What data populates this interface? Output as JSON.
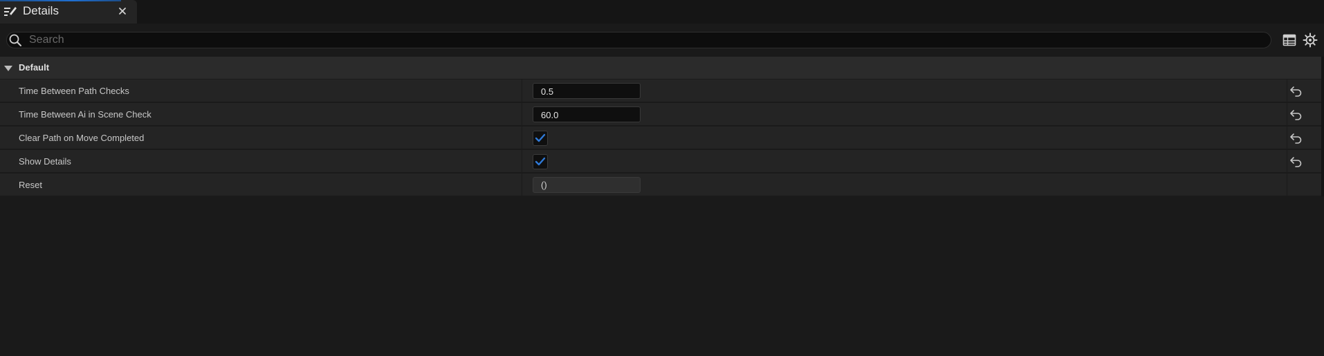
{
  "tab": {
    "title": "Details",
    "icon": "pencil-details-icon",
    "close_icon": "close-icon"
  },
  "search": {
    "placeholder": "Search",
    "value": "",
    "icons": [
      "search-icon",
      "table-view-icon",
      "settings-icon"
    ]
  },
  "category": {
    "label": "Default",
    "expanded": true
  },
  "properties": [
    {
      "name": "Time Between Path Checks",
      "type": "number",
      "value": "0.5",
      "resettable": true
    },
    {
      "name": "Time Between Ai in Scene Check",
      "type": "number",
      "value": "60.0",
      "resettable": true
    },
    {
      "name": "Clear Path on Move Completed",
      "type": "checkbox",
      "checked": true,
      "resettable": true
    },
    {
      "name": "Show Details",
      "type": "checkbox",
      "checked": true,
      "resettable": true
    },
    {
      "name": "Reset",
      "type": "readonly",
      "value": "()",
      "resettable": false
    }
  ],
  "colors": {
    "accent": "#1f6fd1",
    "check": "#2f7ad8",
    "background": "#1a1a1a",
    "row": "#242424",
    "category": "#2b2b2b"
  }
}
